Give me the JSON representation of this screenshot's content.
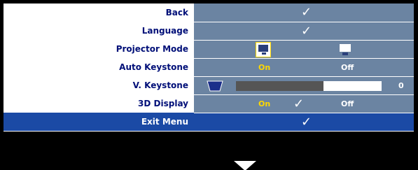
{
  "menu": {
    "back": {
      "label": "Back"
    },
    "language": {
      "label": "Language"
    },
    "projector_mode": {
      "label": "Projector Mode"
    },
    "auto_keystone": {
      "label": "Auto Keystone",
      "on": "On",
      "off": "Off",
      "selected": "On"
    },
    "v_keystone": {
      "label": "V. Keystone",
      "value": "0",
      "level_fraction": 0.6
    },
    "display_3d": {
      "label": "3D Display",
      "on": "On",
      "off": "Off",
      "selected": "On"
    },
    "exit_menu": {
      "label": "Exit Menu"
    }
  },
  "icons": {
    "check": "check-icon",
    "front_projection": "front-projection-icon",
    "ceiling_projection": "ceiling-projection-icon",
    "keystone": "keystone-icon",
    "down_arrow": "down-arrow-icon"
  },
  "colors": {
    "label_text": "#000f78",
    "value_bg": "#6b84a2",
    "selected_text": "#ffd800",
    "exit_bg": "#1b4aa5",
    "slider_fill": "#555555"
  }
}
